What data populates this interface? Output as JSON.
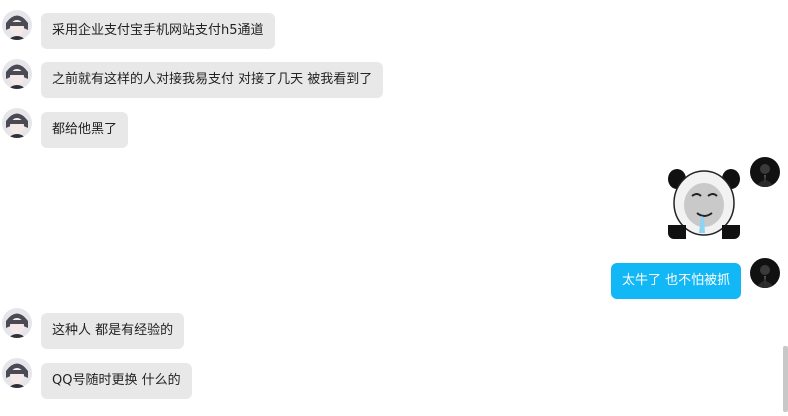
{
  "messages": [
    {
      "side": "in",
      "type": "text",
      "text": "采用企业支付宝手机网站支付h5通道"
    },
    {
      "side": "in",
      "type": "text",
      "text": "之前就有这样的人对接我易支付 对接了几天 被我看到了"
    },
    {
      "side": "in",
      "type": "text",
      "text": "都给他黑了"
    },
    {
      "side": "out",
      "type": "sticker",
      "icon": "panda-meme-sticker"
    },
    {
      "side": "out",
      "type": "text",
      "text": "太牛了 也不怕被抓"
    },
    {
      "side": "in",
      "type": "text",
      "text": "这种人 都是有经验的"
    },
    {
      "side": "in",
      "type": "text",
      "text": "QQ号随时更换 什么的"
    }
  ],
  "colors": {
    "incoming_bubble": "#e8e8e8",
    "outgoing_bubble": "#12b7f5",
    "background": "#ffffff"
  }
}
